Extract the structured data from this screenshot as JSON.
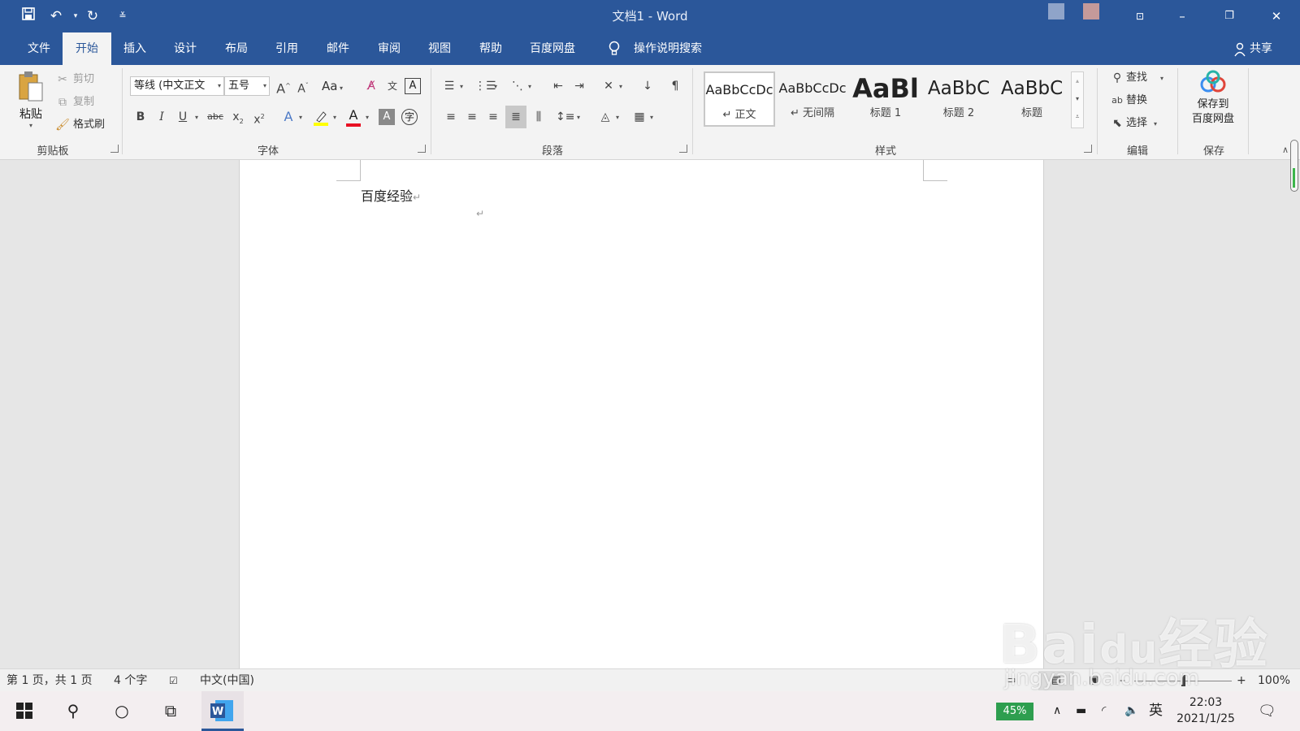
{
  "window": {
    "title": "文档1  -  Word"
  },
  "quick_access": {
    "save": "save-icon",
    "undo": "undo-icon",
    "redo": "redo-icon",
    "customize": "customize-icon"
  },
  "window_controls": {
    "ribbon_display": "ribbon-display-icon",
    "minimize": "minimize-icon",
    "restore": "restore-icon",
    "close": "close-icon"
  },
  "tabs": [
    {
      "label": "文件"
    },
    {
      "label": "开始"
    },
    {
      "label": "插入"
    },
    {
      "label": "设计"
    },
    {
      "label": "布局"
    },
    {
      "label": "引用"
    },
    {
      "label": "邮件"
    },
    {
      "label": "审阅"
    },
    {
      "label": "视图"
    },
    {
      "label": "帮助"
    },
    {
      "label": "百度网盘"
    }
  ],
  "active_tab": "开始",
  "tell_me": "操作说明搜索",
  "share": "共享",
  "clipboard": {
    "paste": "粘贴",
    "cut": "剪切",
    "copy": "复制",
    "format_painter": "格式刷",
    "group": "剪贴板"
  },
  "font": {
    "name": "等线 (中文正文",
    "size": "五号",
    "case": "Aa",
    "group": "字体"
  },
  "paragraph": {
    "group": "段落"
  },
  "styles": {
    "group": "样式",
    "items": [
      {
        "sample": "AaBbCcDc",
        "name": "正文",
        "mark": "↵"
      },
      {
        "sample": "AaBbCcDc",
        "name": "无间隔",
        "mark": "↵"
      },
      {
        "sample": "AaBl",
        "name": "标题 1"
      },
      {
        "sample": "AaBbC",
        "name": "标题 2"
      },
      {
        "sample": "AaBbC",
        "name": "标题"
      }
    ]
  },
  "editing": {
    "find": "查找",
    "replace": "替换",
    "select": "选择",
    "group": "编辑"
  },
  "save_group": {
    "line1": "保存到",
    "line2": "百度网盘",
    "group": "保存"
  },
  "document": {
    "text": "百度经验",
    "para_mark": "↵"
  },
  "status": {
    "page": "第 1 页，共 1 页",
    "words": "4 个字",
    "language": "中文(中国)",
    "zoom": "100%"
  },
  "taskbar": {
    "battery": "45%",
    "ime": "英",
    "time": "22:03",
    "date": "2021/1/25"
  },
  "watermark": {
    "brand": "Bai",
    "paw": "du",
    "cn": "经验",
    "url": "jingyan.baidu.com"
  },
  "colors": {
    "accent": "#2b579a",
    "font_color": "#e81123",
    "highlight": "#ffff00",
    "battery": "#2e9e4f"
  }
}
